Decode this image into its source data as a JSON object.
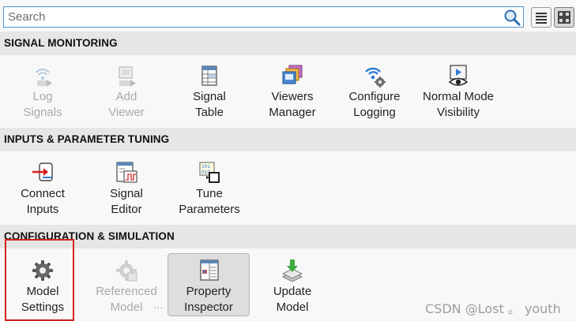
{
  "search": {
    "placeholder": "Search",
    "value": ""
  },
  "sections": [
    {
      "title": "SIGNAL MONITORING",
      "items": [
        {
          "label": "Log\nSignals",
          "icon": "log-signals-icon",
          "enabled": false
        },
        {
          "label": "Add\nViewer",
          "icon": "add-viewer-icon",
          "enabled": false
        },
        {
          "label": "Signal\nTable",
          "icon": "signal-table-icon",
          "enabled": true
        },
        {
          "label": "Viewers\nManager",
          "icon": "viewers-manager-icon",
          "enabled": true
        },
        {
          "label": "Configure\nLogging",
          "icon": "configure-logging-icon",
          "enabled": true
        },
        {
          "label": "Normal Mode\nVisibility",
          "icon": "normal-mode-visibility-icon",
          "enabled": true
        }
      ]
    },
    {
      "title": "INPUTS & PARAMETER TUNING",
      "items": [
        {
          "label": "Connect\nInputs",
          "icon": "connect-inputs-icon",
          "enabled": true
        },
        {
          "label": "Signal\nEditor",
          "icon": "signal-editor-icon",
          "enabled": true
        },
        {
          "label": "Tune\nParameters",
          "icon": "tune-parameters-icon",
          "enabled": true
        }
      ]
    },
    {
      "title": "CONFIGURATION & SIMULATION",
      "items": [
        {
          "label": "Model\nSettings",
          "icon": "gear-icon",
          "enabled": true
        },
        {
          "label": "Referenced\nModel",
          "icon": "referenced-model-icon",
          "enabled": false
        },
        {
          "label": "Property\nInspector",
          "icon": "property-inspector-icon",
          "enabled": true,
          "selected": true
        },
        {
          "label": "Update\nModel",
          "icon": "update-model-icon",
          "enabled": true
        }
      ]
    }
  ],
  "more_indicator": "...",
  "watermark": "CSDN @Lost 。 youth"
}
